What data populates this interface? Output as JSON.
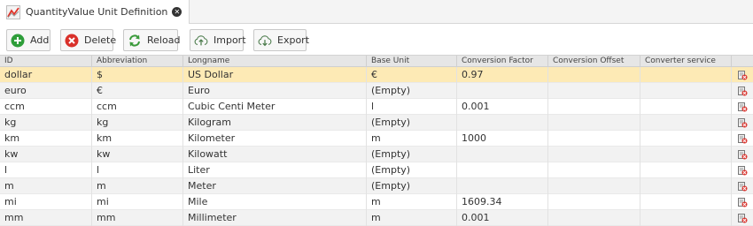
{
  "tab": {
    "title": "QuantityValue Unit Definition",
    "icon": "chart-line-icon",
    "close_icon": "close-icon"
  },
  "toolbar": {
    "add": {
      "label": "Add",
      "icon": "plus-circle-icon",
      "color": "#2e9e3a"
    },
    "delete": {
      "label": "Delete",
      "icon": "x-circle-icon",
      "color": "#d9302a"
    },
    "reload": {
      "label": "Reload",
      "icon": "refresh-icon",
      "color": "#3a9a3a"
    },
    "import": {
      "label": "Import",
      "icon": "cloud-upload-icon",
      "color": "#4a7a4a"
    },
    "export": {
      "label": "Export",
      "icon": "cloud-download-icon",
      "color": "#4a7a4a"
    }
  },
  "table": {
    "columns": [
      "ID",
      "Abbreviation",
      "Longname",
      "Base Unit",
      "Conversion Factor",
      "Conversion Offset",
      "Converter service"
    ],
    "rows": [
      {
        "id": "dollar",
        "abbreviation": "$",
        "longname": "US Dollar",
        "base_unit": "€",
        "factor": "0.97",
        "offset": "",
        "converter": ""
      },
      {
        "id": "euro",
        "abbreviation": "€",
        "longname": "Euro",
        "base_unit": "(Empty)",
        "factor": "",
        "offset": "",
        "converter": ""
      },
      {
        "id": "ccm",
        "abbreviation": "ccm",
        "longname": "Cubic Centi Meter",
        "base_unit": "l",
        "factor": "0.001",
        "offset": "",
        "converter": ""
      },
      {
        "id": "kg",
        "abbreviation": "kg",
        "longname": "Kilogram",
        "base_unit": "(Empty)",
        "factor": "",
        "offset": "",
        "converter": ""
      },
      {
        "id": "km",
        "abbreviation": "km",
        "longname": "Kilometer",
        "base_unit": "m",
        "factor": "1000",
        "offset": "",
        "converter": ""
      },
      {
        "id": "kw",
        "abbreviation": "kw",
        "longname": "Kilowatt",
        "base_unit": "(Empty)",
        "factor": "",
        "offset": "",
        "converter": ""
      },
      {
        "id": "l",
        "abbreviation": "l",
        "longname": "Liter",
        "base_unit": "(Empty)",
        "factor": "",
        "offset": "",
        "converter": ""
      },
      {
        "id": "m",
        "abbreviation": "m",
        "longname": "Meter",
        "base_unit": "(Empty)",
        "factor": "",
        "offset": "",
        "converter": ""
      },
      {
        "id": "mi",
        "abbreviation": "mi",
        "longname": "Mile",
        "base_unit": "m",
        "factor": "1609.34",
        "offset": "",
        "converter": ""
      },
      {
        "id": "mm",
        "abbreviation": "mm",
        "longname": "Millimeter",
        "base_unit": "m",
        "factor": "0.001",
        "offset": "",
        "converter": ""
      }
    ],
    "selected_row": 0,
    "row_action_icon": "delete-row-icon",
    "colors": {
      "selected": "#fdeab5",
      "header": "#e6e6e6",
      "alt_row": "#f2f2f2"
    }
  }
}
